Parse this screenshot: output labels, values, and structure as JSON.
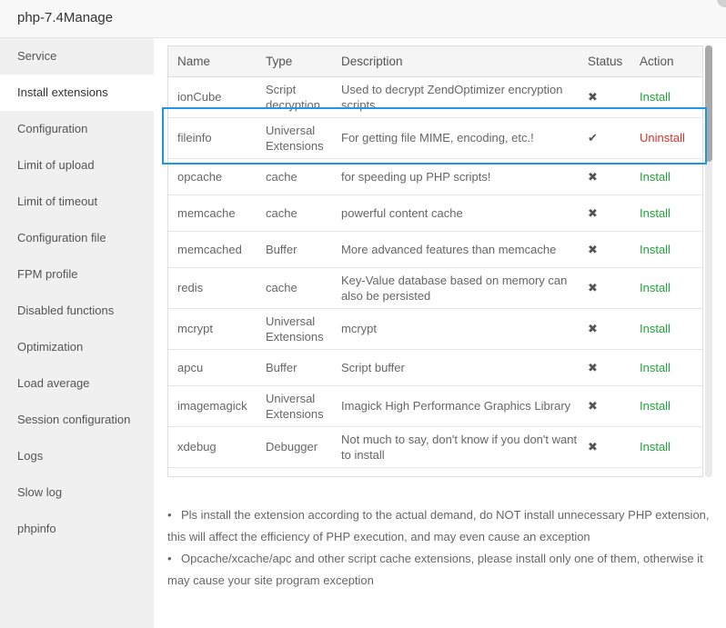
{
  "window": {
    "title": "php-7.4Manage"
  },
  "sidebar": {
    "active": "Install extensions",
    "items": [
      {
        "label": "Service"
      },
      {
        "label": "Install extensions"
      },
      {
        "label": "Configuration"
      },
      {
        "label": "Limit of upload"
      },
      {
        "label": "Limit of timeout"
      },
      {
        "label": "Configuration file"
      },
      {
        "label": "FPM profile"
      },
      {
        "label": "Disabled functions"
      },
      {
        "label": "Optimization"
      },
      {
        "label": "Load average"
      },
      {
        "label": "Session configuration"
      },
      {
        "label": "Logs"
      },
      {
        "label": "Slow log"
      },
      {
        "label": "phpinfo"
      }
    ]
  },
  "table": {
    "headers": {
      "name": "Name",
      "type": "Type",
      "description": "Description",
      "status": "Status",
      "action": "Action"
    },
    "rows": [
      {
        "name": "ionCube",
        "type": "Script decryption",
        "description": "Used to decrypt ZendOptimizer encryption scripts",
        "status": "not-installed",
        "status_glyph": "✖",
        "action": "Install"
      },
      {
        "name": "fileinfo",
        "type": "Universal Extensions",
        "description": "For getting file MIME, encoding, etc.!",
        "status": "installed",
        "status_glyph": "✔",
        "action": "Uninstall"
      },
      {
        "name": "opcache",
        "type": "cache",
        "description": "for speeding up PHP scripts!",
        "status": "not-installed",
        "status_glyph": "✖",
        "action": "Install"
      },
      {
        "name": "memcache",
        "type": "cache",
        "description": "powerful content cache",
        "status": "not-installed",
        "status_glyph": "✖",
        "action": "Install"
      },
      {
        "name": "memcached",
        "type": "Buffer",
        "description": "More advanced features than memcache",
        "status": "not-installed",
        "status_glyph": "✖",
        "action": "Install"
      },
      {
        "name": "redis",
        "type": "cache",
        "description": "Key-Value database based on memory can also be persisted",
        "status": "not-installed",
        "status_glyph": "✖",
        "action": "Install"
      },
      {
        "name": "mcrypt",
        "type": "Universal Extensions",
        "description": "mcrypt",
        "status": "not-installed",
        "status_glyph": "✖",
        "action": "Install"
      },
      {
        "name": "apcu",
        "type": "Buffer",
        "description": "Script buffer",
        "status": "not-installed",
        "status_glyph": "✖",
        "action": "Install"
      },
      {
        "name": "imagemagick",
        "type": "Universal Extensions",
        "description": "Imagick High Performance Graphics Library",
        "status": "not-installed",
        "status_glyph": "✖",
        "action": "Install"
      },
      {
        "name": "xdebug",
        "type": "Debugger",
        "description": "Not much to say, don't know if you don't want to install",
        "status": "not-installed",
        "status_glyph": "✖",
        "action": "Install"
      }
    ]
  },
  "notes": [
    "Pls install the extension according to the actual demand, do NOT install unnecessary PHP extension, this will affect the efficiency of PHP execution, and may even cause an exception",
    "Opcache/xcache/apc and other script cache extensions, please install only one of them, otherwise it may cause your site program exception"
  ],
  "colors": {
    "install": "#20a53a",
    "uninstall": "#e0302a",
    "highlight": "#1f97e6"
  }
}
